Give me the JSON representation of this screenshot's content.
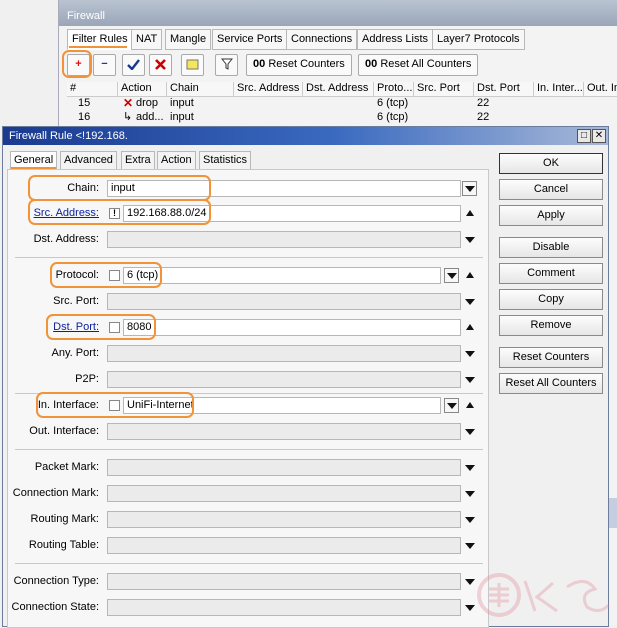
{
  "back_window": {
    "title": "Firewall",
    "tabs": [
      "Filter Rules",
      "NAT",
      "Mangle",
      "Service Ports",
      "Connections",
      "Address Lists",
      "Layer7 Protocols"
    ],
    "toolbar": {
      "add_icon": "+",
      "remove_icon": "−",
      "reset_counters": "Reset Counters",
      "reset_all_counters": "Reset All Counters",
      "counter_prefix": "00"
    },
    "table": {
      "columns": [
        "#",
        "Action",
        "Chain",
        "Src. Address",
        "Dst. Address",
        "Proto...",
        "Src. Port",
        "Dst. Port",
        "In. Inter...",
        "Out. Int..."
      ],
      "rows": [
        {
          "num": "15",
          "action": "drop",
          "chain": "input",
          "proto": "6 (tcp)",
          "dst_port": "22"
        },
        {
          "num": "16",
          "action": "add...",
          "chain": "input",
          "proto": "6 (tcp)",
          "dst_port": "22"
        }
      ]
    }
  },
  "dialog": {
    "title": "Firewall Rule <!192.168.",
    "tabs": [
      "General",
      "Advanced",
      "Extra",
      "Action",
      "Statistics"
    ],
    "fields": {
      "chain": {
        "label": "Chain:",
        "value": "input"
      },
      "src_address": {
        "label": "Src. Address:",
        "neg": "!",
        "value": "192.168.88.0/24"
      },
      "dst_address": {
        "label": "Dst. Address:",
        "value": ""
      },
      "protocol": {
        "label": "Protocol:",
        "value": "6 (tcp)"
      },
      "src_port": {
        "label": "Src. Port:",
        "value": ""
      },
      "dst_port": {
        "label": "Dst. Port:",
        "value": "8080"
      },
      "any_port": {
        "label": "Any. Port:",
        "value": ""
      },
      "p2p": {
        "label": "P2P:",
        "value": ""
      },
      "in_interface": {
        "label": "In. Interface:",
        "value": "UniFi-Internet"
      },
      "out_interface": {
        "label": "Out. Interface:",
        "value": ""
      },
      "packet_mark": {
        "label": "Packet Mark:",
        "value": ""
      },
      "connection_mark": {
        "label": "Connection Mark:",
        "value": ""
      },
      "routing_mark": {
        "label": "Routing Mark:",
        "value": ""
      },
      "routing_table": {
        "label": "Routing Table:",
        "value": ""
      },
      "connection_type": {
        "label": "Connection Type:",
        "value": ""
      },
      "connection_state": {
        "label": "Connection State:",
        "value": ""
      }
    },
    "buttons": [
      "OK",
      "Cancel",
      "Apply",
      "Disable",
      "Comment",
      "Copy",
      "Remove",
      "Reset Counters",
      "Reset All Counters"
    ]
  },
  "colors": {
    "highlight": "#f0933a",
    "title_bar": "#1a3a8f",
    "link_label": "#0a1f9c"
  }
}
